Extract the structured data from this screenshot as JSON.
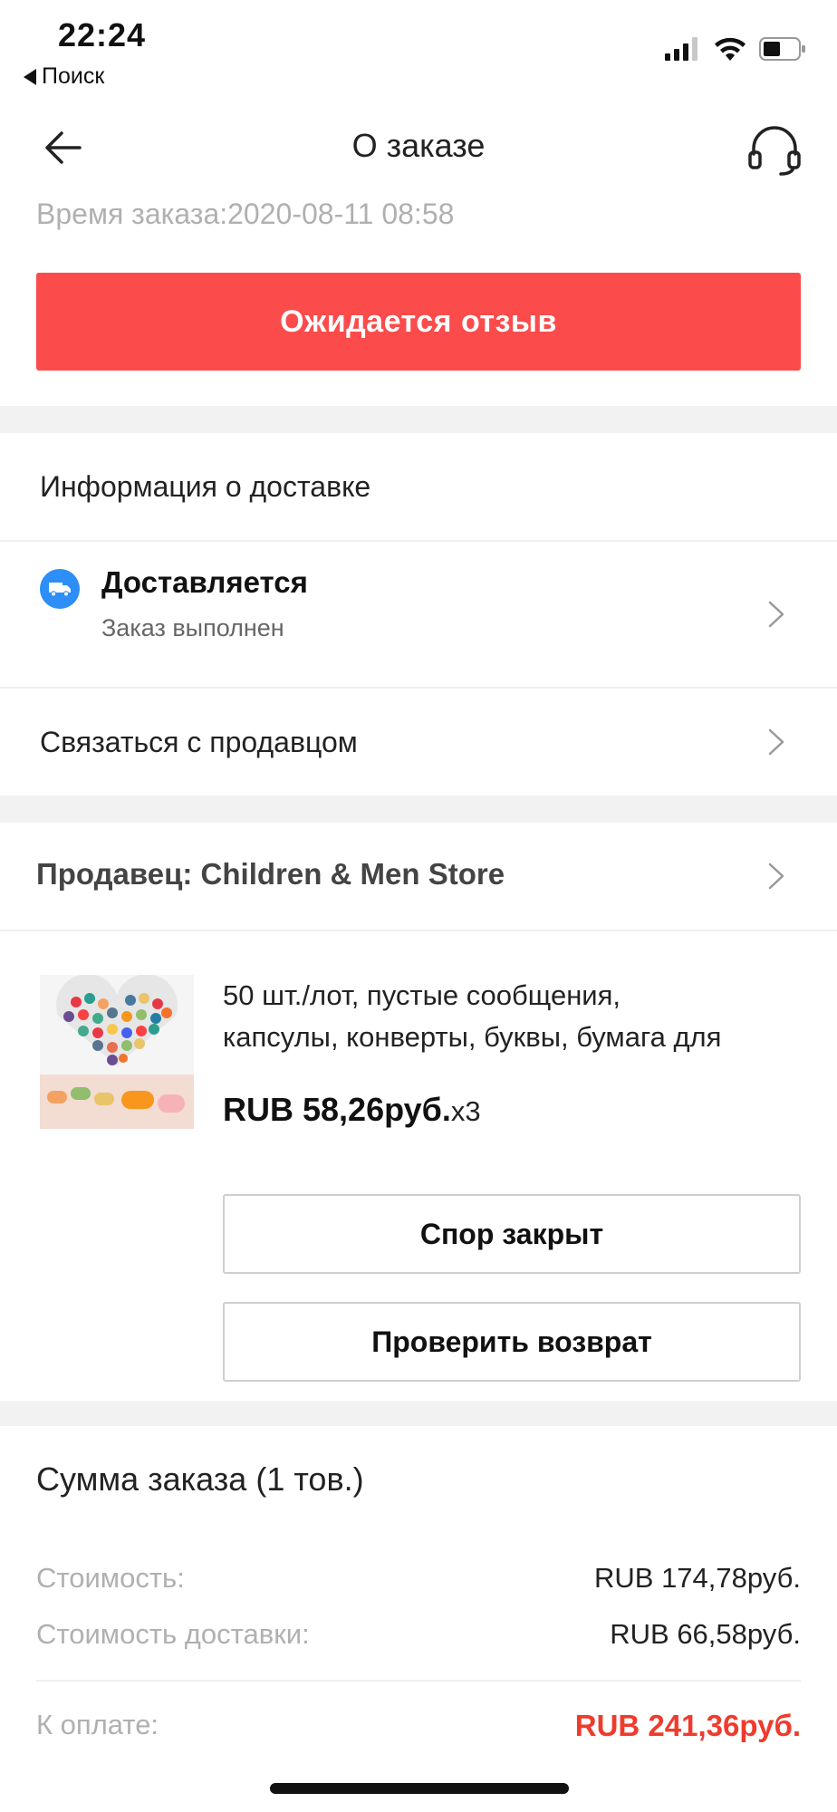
{
  "status_bar": {
    "time": "22:24",
    "back_label": "Поиск"
  },
  "nav": {
    "title": "О заказе"
  },
  "order": {
    "time_label": "Время заказа:2020-08-11 08:58",
    "status_banner": "Ожидается отзыв"
  },
  "delivery": {
    "section_title": "Информация о доставке",
    "status_title": "Доставляется",
    "status_subtitle": "Заказ выполнен",
    "contact_seller": "Связаться с продавцом"
  },
  "seller": {
    "label": "Продавец: Children & Men Store"
  },
  "product": {
    "title_line1": "50 шт./лот, пустые сообщения,",
    "title_line2": "капсулы, конверты, буквы, бумага для",
    "price": "RUB 58,26руб.",
    "quantity": "x3"
  },
  "actions": {
    "dispute_closed": "Спор закрыт",
    "check_return": "Проверить возврат"
  },
  "summary": {
    "title": "Сумма заказа (1 тов.)",
    "rows": [
      {
        "label": "Стоимость:",
        "value": "RUB 174,78руб."
      },
      {
        "label": "Стоимость доставки:",
        "value": "RUB 66,58руб."
      }
    ],
    "total_label": "К оплате:",
    "total_value": "RUB 241,36руб."
  },
  "colors": {
    "accent_red": "#fb4b4b",
    "total_red": "#ef3b2d",
    "truck_blue": "#2c8ef6",
    "section_gap": "#f2f2f2"
  }
}
